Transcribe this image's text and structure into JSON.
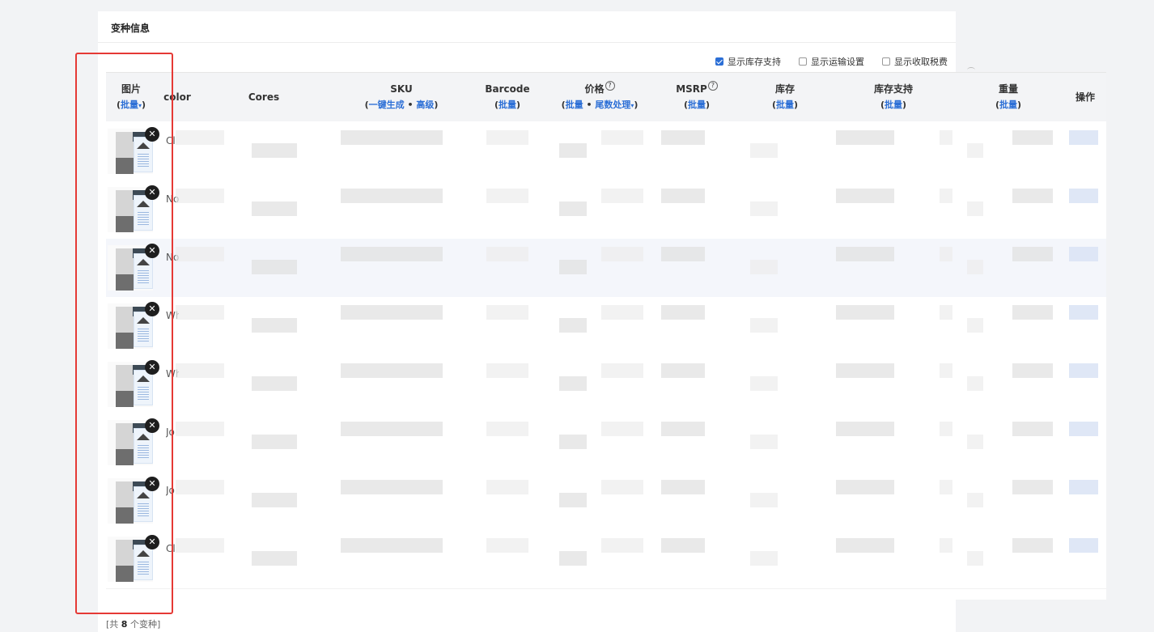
{
  "section": {
    "title": "变种信息",
    "options": [
      {
        "label": "显示库存支持",
        "checked": true
      },
      {
        "label": "显示运输设置",
        "checked": false
      },
      {
        "label": "显示收取税费",
        "checked": false
      }
    ]
  },
  "columns": {
    "image": {
      "label": "图片",
      "sub_open": "(",
      "action": "批量",
      "sub_close": ")"
    },
    "color": {
      "label": "color"
    },
    "cores": {
      "label": "Cores"
    },
    "sku": {
      "label": "SKU",
      "sub_open": "(",
      "action1": "一键生成",
      "sep": " • ",
      "action2": "高级",
      "sub_close": ")"
    },
    "barcode": {
      "label": "Barcode",
      "sub_open": "(",
      "action": "批量",
      "sub_close": ")"
    },
    "price": {
      "label": "价格",
      "sub_open": "(",
      "action1": "批量",
      "sep": " • ",
      "action2": "尾数处理",
      "sub_close": ")"
    },
    "msrp": {
      "label": "MSRP",
      "sub_open": "(",
      "action": "批量",
      "sub_close": ")"
    },
    "stock": {
      "label": "库存",
      "sub_open": "(",
      "action": "批量",
      "sub_close": ")"
    },
    "stock_support": {
      "label": "库存支持",
      "sub_open": "(",
      "action": "批量",
      "sub_close": ")"
    },
    "weight": {
      "label": "重量",
      "sub_open": "(",
      "action": "批量",
      "sub_close": ")"
    },
    "ops": {
      "label": "操作"
    }
  },
  "icons": {
    "help": "question-circle-icon",
    "caret": "caret-down-icon",
    "remove": "close-circle-icon",
    "checkbox": "checkbox-icon"
  },
  "rows": [
    {
      "color": "Cl"
    },
    {
      "color": "No G"
    },
    {
      "color": "No"
    },
    {
      "color": "Wh"
    },
    {
      "color": "Wh"
    },
    {
      "color": "Jo"
    },
    {
      "color": "Jo"
    },
    {
      "color": "Cl"
    }
  ],
  "glyphs": {
    "help": "?",
    "caret": "▾",
    "remove": "✕"
  },
  "footer": {
    "prefix": "[共 ",
    "count": "8",
    "suffix": " 个变种]"
  },
  "colors": {
    "accent": "#2c6fd6",
    "highlight": "#e53935"
  }
}
